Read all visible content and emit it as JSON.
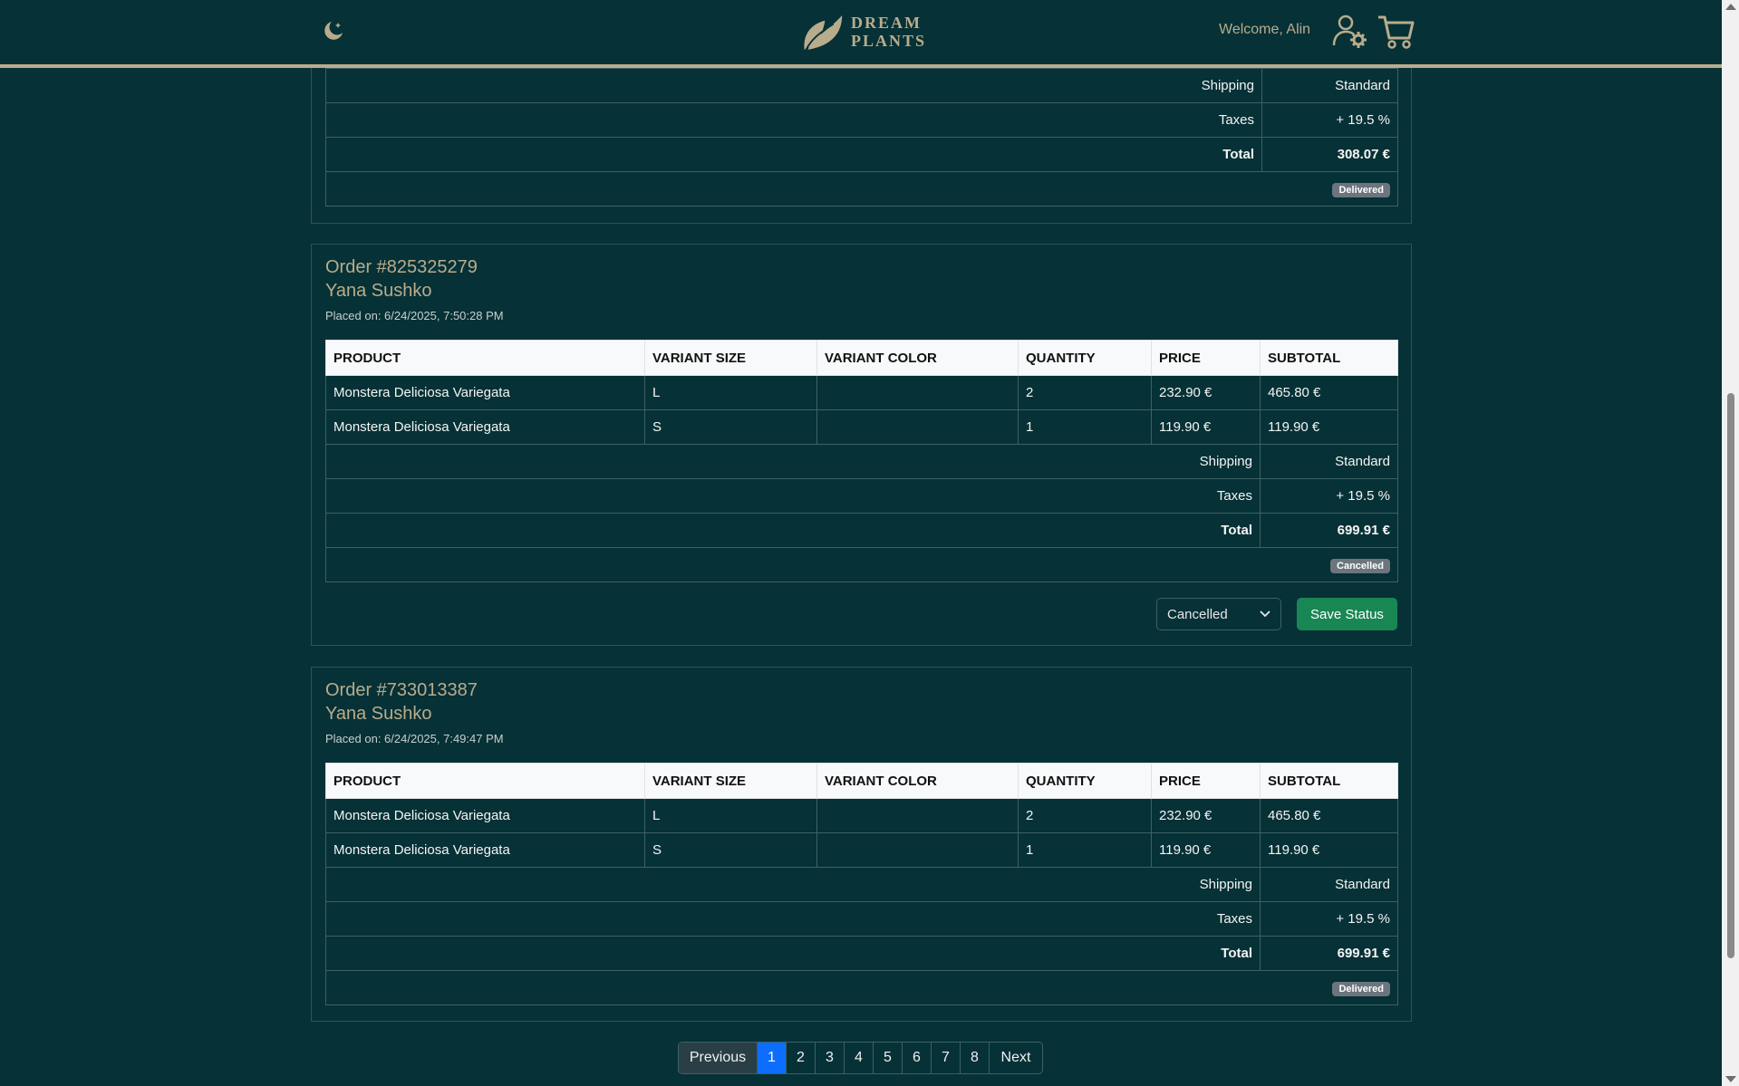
{
  "header": {
    "theme_icon": "moon-icon",
    "logo_line1": "DREAM",
    "logo_line2": "PLANTS",
    "welcome": "Welcome, Alin",
    "account_icon": "user-gear-icon",
    "cart_icon": "cart-icon"
  },
  "table_headers": [
    "PRODUCT",
    "VARIANT SIZE",
    "VARIANT COLOR",
    "QUANTITY",
    "PRICE",
    "SUBTOTAL"
  ],
  "summary_labels": {
    "shipping": "Shipping",
    "taxes": "Taxes",
    "total": "Total"
  },
  "orders": [
    {
      "shipping": "Standard",
      "taxes": "+ 19.5 %",
      "total": "308.07 €",
      "status_badge": "Delivered"
    },
    {
      "title": "Order #825325279",
      "customer": "Yana Sushko",
      "placed_on": "Placed on: 6/24/2025, 7:50:28 PM",
      "items": [
        {
          "product": "Monstera Deliciosa Variegata",
          "size": "L",
          "color": "",
          "quantity": "2",
          "price": "232.90 €",
          "subtotal": "465.80 €"
        },
        {
          "product": "Monstera Deliciosa Variegata",
          "size": "S",
          "color": "",
          "quantity": "1",
          "price": "119.90 €",
          "subtotal": "119.90 €"
        }
      ],
      "shipping": "Standard",
      "taxes": "+ 19.5 %",
      "total": "699.91 €",
      "status_badge": "Cancelled",
      "status_select_value": "Cancelled",
      "save_label": "Save Status"
    },
    {
      "title": "Order #733013387",
      "customer": "Yana Sushko",
      "placed_on": "Placed on: 6/24/2025, 7:49:47 PM",
      "items": [
        {
          "product": "Monstera Deliciosa Variegata",
          "size": "L",
          "color": "",
          "quantity": "2",
          "price": "232.90 €",
          "subtotal": "465.80 €"
        },
        {
          "product": "Monstera Deliciosa Variegata",
          "size": "S",
          "color": "",
          "quantity": "1",
          "price": "119.90 €",
          "subtotal": "119.90 €"
        }
      ],
      "shipping": "Standard",
      "taxes": "+ 19.5 %",
      "total": "699.91 €",
      "status_badge": "Delivered"
    }
  ],
  "pagination": {
    "previous": "Previous",
    "pages": [
      "1",
      "2",
      "3",
      "4",
      "5",
      "6",
      "7",
      "8"
    ],
    "active_page": "1",
    "next": "Next"
  },
  "colors": {
    "background": "#063136",
    "accent": "#b9ac8c",
    "save_button": "#198754",
    "active_page": "#0d6efd",
    "badge": "#6c757d"
  }
}
